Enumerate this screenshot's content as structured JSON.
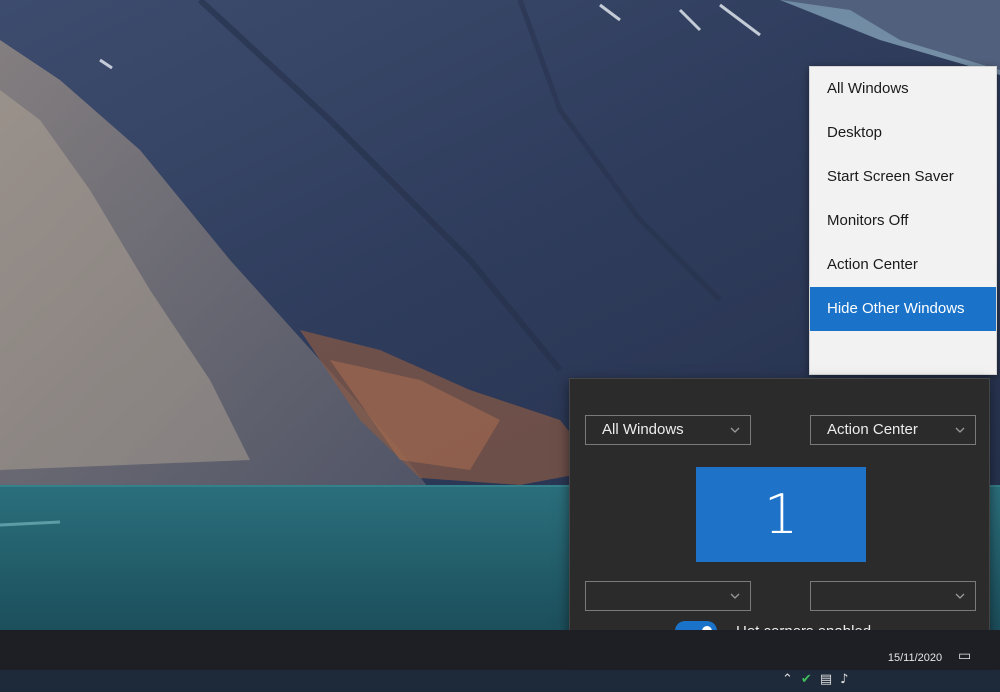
{
  "context_menu": {
    "items": [
      {
        "label": "All Windows"
      },
      {
        "label": "Desktop"
      },
      {
        "label": "Start Screen Saver"
      },
      {
        "label": "Monitors Off"
      },
      {
        "label": "Action Center"
      },
      {
        "label": "Hide Other Windows",
        "selected": true
      }
    ]
  },
  "hot_corners": {
    "top_left_value": "All Windows",
    "top_right_value": "Action Center",
    "bottom_left_value": "",
    "bottom_right_value": "",
    "monitor_number": "1",
    "toggle_label": "Hot corners enabled",
    "toggle_on": true
  },
  "taskbar": {
    "date": "15/11/2020",
    "tray_icons": [
      "chevron-up-icon",
      "shield-check-icon",
      "network-icon",
      "volume-icon"
    ],
    "notification_icon": "action-center-icon"
  },
  "colors": {
    "accent": "#1a73c9",
    "panel_bg": "#2b2b2b",
    "menu_bg": "#f2f2f2",
    "taskbar_bg": "#1d1f24"
  }
}
